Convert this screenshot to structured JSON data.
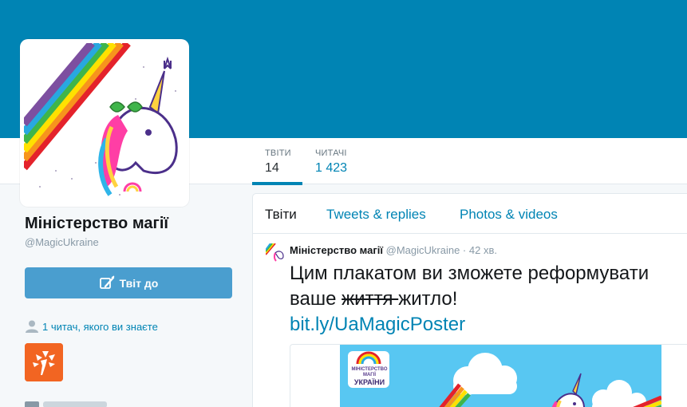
{
  "profile": {
    "name": "Міністерство магії",
    "handle": "@MagicUkraine"
  },
  "stats": {
    "tweets_label": "ТВІТИ",
    "tweets_value": "14",
    "followers_label": "ЧИТАЧІ",
    "followers_value": "1 423"
  },
  "sidebar": {
    "tweet_to_label": "Твіт до",
    "followers_you_know": "1 читач, якого ви знаєте"
  },
  "timeline": {
    "tabs": [
      {
        "label": "Твіти",
        "active": true
      },
      {
        "label": "Tweets & replies",
        "active": false
      },
      {
        "label": "Photos & videos",
        "active": false
      }
    ]
  },
  "tweet": {
    "name": "Міністерство магії",
    "handle": "@MagicUkraine",
    "dot": "·",
    "time": "42 хв.",
    "text_line1": "Цим плакатом ви зможете реформувати",
    "text_line2_start": "ваше ",
    "text_strike": "життя ",
    "text_line2_end": "житло!",
    "link": "bit.ly/UaMagicPoster",
    "card_text_small": "МІНІСТЕРСТВО МАГІЇ",
    "card_text_big": "УКРАЇНИ"
  },
  "colors": {
    "banner": "#0084b4",
    "accent": "#0084b4",
    "button": "#4a9ecf",
    "rfe_orange": "#f26522"
  },
  "icons": {
    "tweet_button": "compose-quill-icon",
    "followers": "person-icon"
  }
}
